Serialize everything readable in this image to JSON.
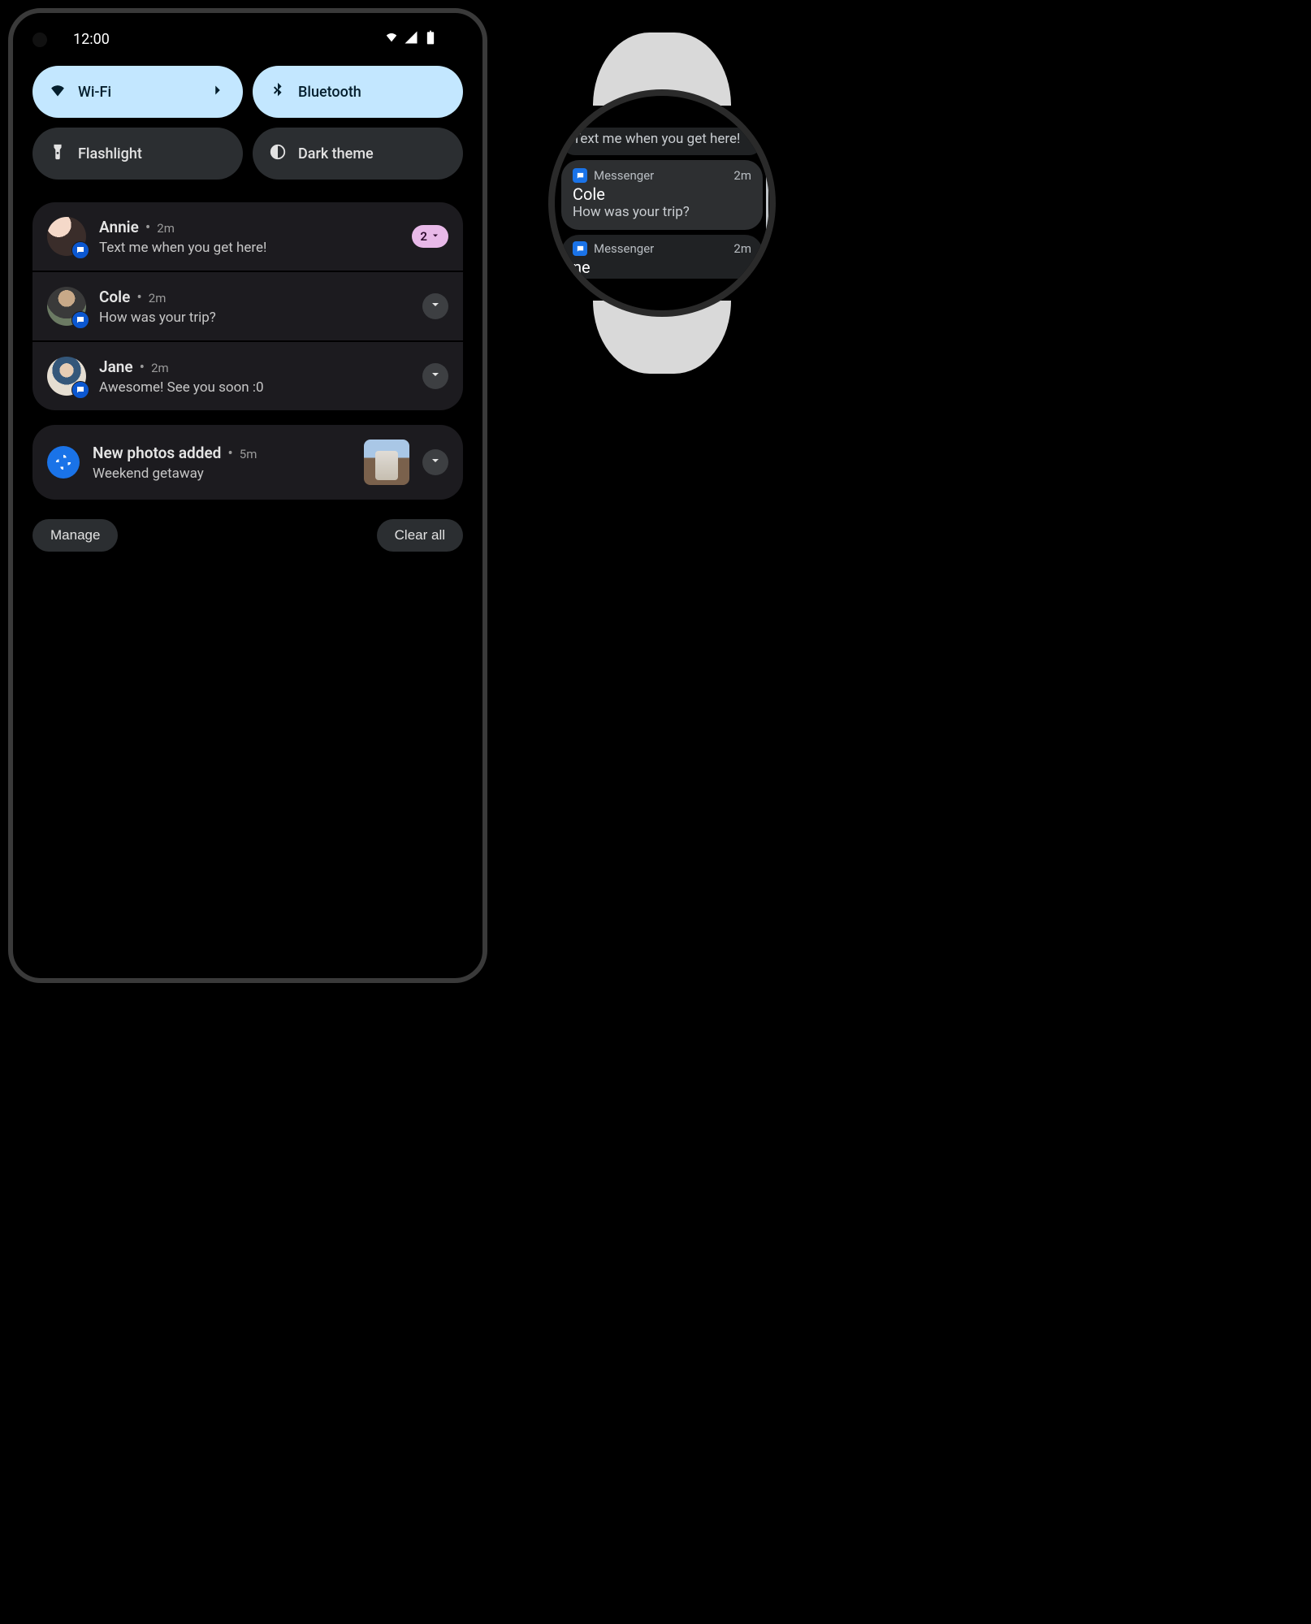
{
  "status": {
    "time": "12:00"
  },
  "qs": {
    "wifi": {
      "label": "Wi-Fi",
      "on": true
    },
    "bluetooth": {
      "label": "Bluetooth",
      "on": true
    },
    "flashlight": {
      "label": "Flashlight",
      "on": false
    },
    "darktheme": {
      "label": "Dark theme",
      "on": false
    }
  },
  "notifications": {
    "messages": [
      {
        "sender": "Annie",
        "time": "2m",
        "text": "Text me when you get here!",
        "count": "2"
      },
      {
        "sender": "Cole",
        "time": "2m",
        "text": "How was your trip?"
      },
      {
        "sender": "Jane",
        "time": "2m",
        "text": "Awesome! See you soon :0"
      }
    ],
    "photos": {
      "title": "New photos added",
      "time": "5m",
      "subtitle": "Weekend getaway"
    },
    "manage_label": "Manage",
    "clear_label": "Clear all"
  },
  "watch": {
    "app": "Messenger",
    "cards": [
      {
        "text": "Text me when you get here!"
      },
      {
        "sender": "Cole",
        "time": "2m",
        "text": "How was your trip?"
      },
      {
        "sender_partial": "ne",
        "time": "2m"
      }
    ]
  }
}
